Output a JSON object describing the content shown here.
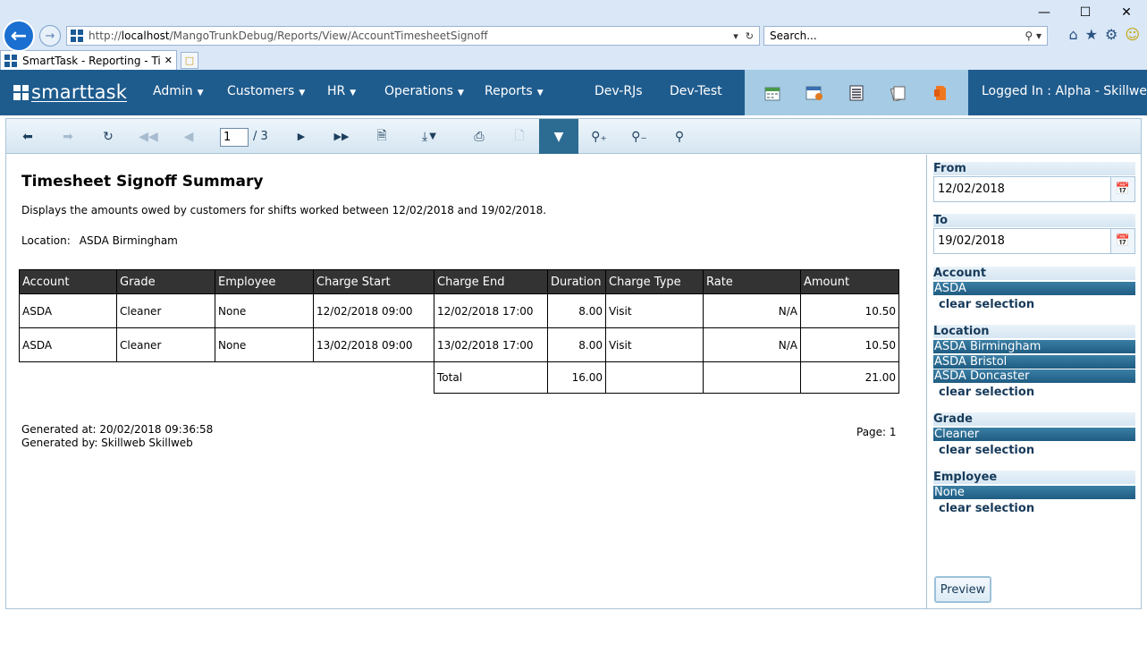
{
  "browser": {
    "url_prefix": "http://",
    "url_host": "localhost",
    "url_path": "/MangoTrunkDebug/Reports/View/AccountTimesheetSignoff",
    "search_placeholder": "Search...",
    "tab_title": "SmartTask - Reporting - Ti..."
  },
  "app": {
    "logo": "smarttask",
    "nav": [
      {
        "label": "Admin",
        "caret": true
      },
      {
        "label": "Customers",
        "caret": true
      },
      {
        "label": "HR",
        "caret": true
      },
      {
        "label": "Operations",
        "caret": true
      },
      {
        "label": "Reports",
        "caret": true
      },
      {
        "label": "Dev-RJs",
        "caret": false
      },
      {
        "label": "Dev-Test",
        "caret": false
      }
    ],
    "nav_icons": [
      "calendar-icon",
      "schedule-icon",
      "list-icon",
      "documents-icon",
      "report-icon"
    ],
    "logged_in": "Logged In : Alpha - Skillweb"
  },
  "toolbar": {
    "page_current": "1",
    "page_total": "/ 3",
    "active_tool": "filter"
  },
  "report": {
    "title": "Timesheet Signoff Summary",
    "description": "Displays the amounts owed by customers for shifts worked between 12/02/2018 and 19/02/2018.",
    "location_label": "Location:",
    "location_value": "ASDA Birmingham",
    "columns": [
      "Account",
      "Grade",
      "Employee",
      "Charge Start",
      "Charge End",
      "Duration",
      "Charge Type",
      "Rate",
      "Amount"
    ],
    "rows": [
      [
        "ASDA",
        "Cleaner",
        "None",
        "12/02/2018 09:00",
        "12/02/2018 17:00",
        "8.00",
        "Visit",
        "N/A",
        "10.50"
      ],
      [
        "ASDA",
        "Cleaner",
        "None",
        "13/02/2018 09:00",
        "13/02/2018 17:00",
        "8.00",
        "Visit",
        "N/A",
        "10.50"
      ]
    ],
    "total_label": "Total",
    "total_duration": "16.00",
    "total_amount": "21.00",
    "generated_at": "Generated at: 20/02/2018 09:36:58",
    "generated_by": "Generated by: Skillweb Skillweb",
    "page_no": "Page: 1"
  },
  "params": {
    "from_label": "From",
    "from_value": "12/02/2018",
    "to_label": "To",
    "to_value": "19/02/2018",
    "account_label": "Account",
    "account_selected": [
      "ASDA"
    ],
    "location_label": "Location",
    "location_selected": [
      "ASDA Birmingham",
      "ASDA Bristol",
      "ASDA Doncaster"
    ],
    "grade_label": "Grade",
    "grade_selected": [
      "Cleaner"
    ],
    "employee_label": "Employee",
    "employee_selected": [
      "None"
    ],
    "clear_label": "clear selection",
    "preview_label": "Preview"
  }
}
